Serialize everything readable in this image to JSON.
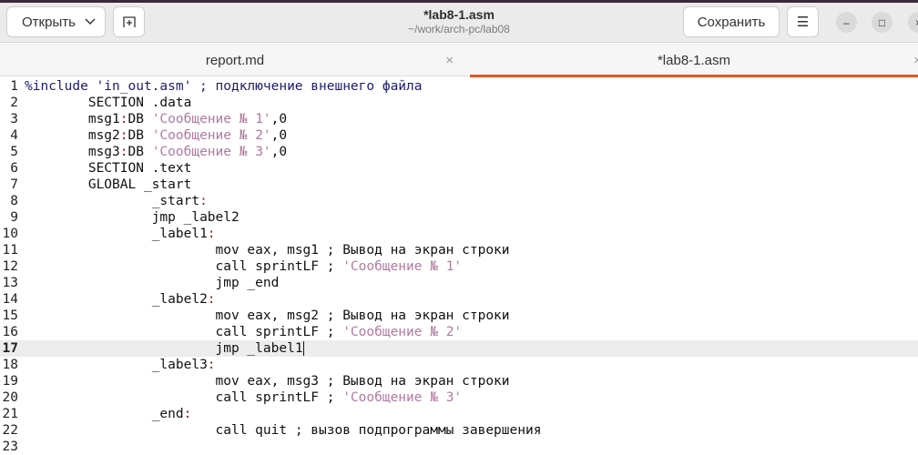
{
  "header": {
    "open_label": "Открыть",
    "new_tab_icon": "new-tab-icon",
    "title": "*lab8-1.asm",
    "subtitle": "~/work/arch-pc/lab08",
    "save_label": "Сохранить",
    "menu_icon": "☰",
    "minimize": "–",
    "maximize": "□",
    "close": "×"
  },
  "tabs": [
    {
      "label": "report.md",
      "close": "×"
    },
    {
      "label": "*lab8-1.asm",
      "close": "×"
    }
  ],
  "editor": {
    "current_line": 17,
    "lines": [
      {
        "n": "1",
        "segs": [
          {
            "t": "%include 'in_out.asm' ; подключение внешнего файла",
            "c": "pre"
          }
        ]
      },
      {
        "n": "2",
        "segs": [
          {
            "t": "\tSECTION .data",
            "c": ""
          }
        ]
      },
      {
        "n": "3",
        "segs": [
          {
            "t": "\tmsg1",
            "c": ""
          },
          {
            "t": ":",
            "c": "lab"
          },
          {
            "t": "DB ",
            "c": ""
          },
          {
            "t": "'Сообщение № 1'",
            "c": "str"
          },
          {
            "t": ",0",
            "c": ""
          }
        ]
      },
      {
        "n": "4",
        "segs": [
          {
            "t": "\tmsg2",
            "c": ""
          },
          {
            "t": ":",
            "c": "lab"
          },
          {
            "t": "DB ",
            "c": ""
          },
          {
            "t": "'Сообщение № 2'",
            "c": "str"
          },
          {
            "t": ",0",
            "c": ""
          }
        ]
      },
      {
        "n": "5",
        "segs": [
          {
            "t": "\tmsg3",
            "c": ""
          },
          {
            "t": ":",
            "c": "lab"
          },
          {
            "t": "DB ",
            "c": ""
          },
          {
            "t": "'Сообщение № 3'",
            "c": "str"
          },
          {
            "t": ",0",
            "c": ""
          }
        ]
      },
      {
        "n": "6",
        "segs": [
          {
            "t": "\tSECTION .text",
            "c": ""
          }
        ]
      },
      {
        "n": "7",
        "segs": [
          {
            "t": "\tGLOBAL _start",
            "c": ""
          }
        ]
      },
      {
        "n": "8",
        "segs": [
          {
            "t": "\t\t_start",
            "c": ""
          },
          {
            "t": ":",
            "c": "lab"
          }
        ]
      },
      {
        "n": "9",
        "segs": [
          {
            "t": "\t\tjmp _label2",
            "c": ""
          }
        ]
      },
      {
        "n": "10",
        "segs": [
          {
            "t": "\t\t_label1",
            "c": ""
          },
          {
            "t": ":",
            "c": "lab"
          }
        ]
      },
      {
        "n": "11",
        "segs": [
          {
            "t": "\t\t\tmov eax, msg1 ; Вывод на экран строки",
            "c": ""
          }
        ]
      },
      {
        "n": "12",
        "segs": [
          {
            "t": "\t\t\tcall sprintLF ; ",
            "c": ""
          },
          {
            "t": "'Сообщение № 1'",
            "c": "str"
          }
        ]
      },
      {
        "n": "13",
        "segs": [
          {
            "t": "\t\t\tjmp _end",
            "c": ""
          }
        ]
      },
      {
        "n": "14",
        "segs": [
          {
            "t": "\t\t_label2",
            "c": ""
          },
          {
            "t": ":",
            "c": "lab"
          }
        ]
      },
      {
        "n": "15",
        "segs": [
          {
            "t": "\t\t\tmov eax, msg2 ; Вывод на экран строки",
            "c": ""
          }
        ]
      },
      {
        "n": "16",
        "segs": [
          {
            "t": "\t\t\tcall sprintLF ; ",
            "c": ""
          },
          {
            "t": "'Сообщение № 2'",
            "c": "str"
          }
        ]
      },
      {
        "n": "17",
        "segs": [
          {
            "t": "\t\t\tjmp _label1",
            "c": ""
          }
        ]
      },
      {
        "n": "18",
        "segs": [
          {
            "t": "\t\t_label3",
            "c": ""
          },
          {
            "t": ":",
            "c": "lab"
          }
        ]
      },
      {
        "n": "19",
        "segs": [
          {
            "t": "\t\t\tmov eax, msg3 ; Вывод на экран строки",
            "c": ""
          }
        ]
      },
      {
        "n": "20",
        "segs": [
          {
            "t": "\t\t\tcall sprintLF ; ",
            "c": ""
          },
          {
            "t": "'Сообщение № 3'",
            "c": "str"
          }
        ]
      },
      {
        "n": "21",
        "segs": [
          {
            "t": "\t\t_end",
            "c": ""
          },
          {
            "t": ":",
            "c": "lab"
          }
        ]
      },
      {
        "n": "22",
        "segs": [
          {
            "t": "\t\t\tcall quit ; вызов подпрограммы завершения",
            "c": ""
          }
        ]
      },
      {
        "n": "23",
        "segs": []
      }
    ]
  }
}
